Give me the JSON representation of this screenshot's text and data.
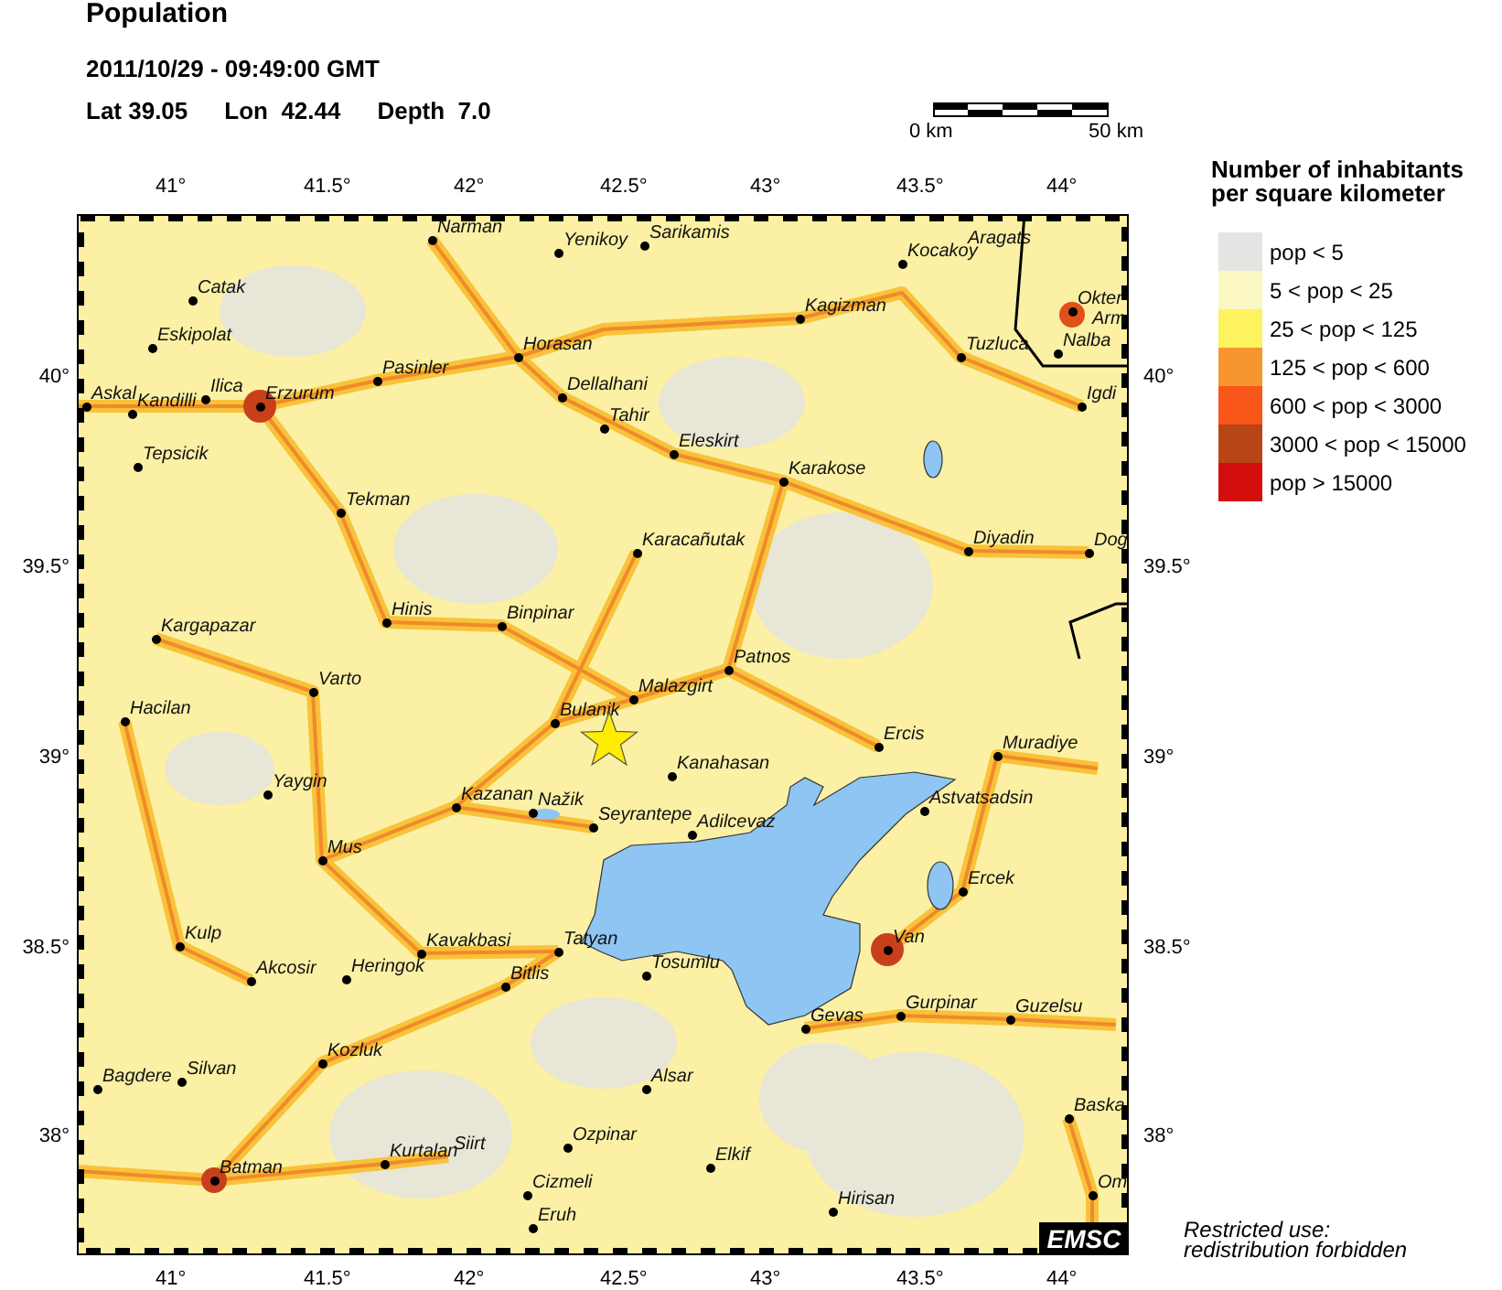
{
  "header": {
    "title": "Population",
    "datetime": "2011/10/29 - 09:49:00 GMT",
    "lat": "Lat 39.05",
    "lon": "Lon  42.44",
    "depth": "Depth  7.0"
  },
  "scale_bar": {
    "start": "0 km",
    "end": "50 km"
  },
  "map": {
    "top_axis": [
      "41°",
      "41.5°",
      "42°",
      "42.5°",
      "43°",
      "43.5°",
      "44°"
    ],
    "bottom_axis": [
      "41°",
      "41.5°",
      "42°",
      "42.5°",
      "43°",
      "43.5°",
      "44°"
    ],
    "left_axis": [
      "40°",
      "39.5°",
      "39°",
      "38.5°",
      "38°"
    ],
    "right_axis": [
      "40°",
      "39.5°",
      "39°",
      "38.5°",
      "38°"
    ],
    "badge": "EMSC",
    "cities": [
      {
        "name": "Narman",
        "kind": "town"
      },
      {
        "name": "Yenikoy",
        "kind": "town"
      },
      {
        "name": "Sarikamis",
        "kind": "town"
      },
      {
        "name": "Kocakoy",
        "kind": "town"
      },
      {
        "name": "Aragats",
        "kind": "label"
      },
      {
        "name": "Catak",
        "kind": "town"
      },
      {
        "name": "Kagizman",
        "kind": "town"
      },
      {
        "name": "Okter",
        "kind": "town"
      },
      {
        "name": "Arm",
        "kind": "label"
      },
      {
        "name": "Eskipolat",
        "kind": "town"
      },
      {
        "name": "Horasan",
        "kind": "town"
      },
      {
        "name": "Tuzluca",
        "kind": "town"
      },
      {
        "name": "Nalba",
        "kind": "town"
      },
      {
        "name": "Pasinler",
        "kind": "town"
      },
      {
        "name": "Askal",
        "kind": "town"
      },
      {
        "name": "Kandilli",
        "kind": "town"
      },
      {
        "name": "Ilica",
        "kind": "town"
      },
      {
        "name": "Erzurum",
        "kind": "town"
      },
      {
        "name": "Dellalhani",
        "kind": "town"
      },
      {
        "name": "Igdi",
        "kind": "town"
      },
      {
        "name": "Tahir",
        "kind": "town"
      },
      {
        "name": "Eleskirt",
        "kind": "town"
      },
      {
        "name": "Tepsicik",
        "kind": "town"
      },
      {
        "name": "Karakose",
        "kind": "town"
      },
      {
        "name": "Tekman",
        "kind": "town"
      },
      {
        "name": "Karacañutak",
        "kind": "town"
      },
      {
        "name": "Diyadin",
        "kind": "town"
      },
      {
        "name": "Dog",
        "kind": "town"
      },
      {
        "name": "Kargapazar",
        "kind": "town"
      },
      {
        "name": "Hinis",
        "kind": "town"
      },
      {
        "name": "Binpinar",
        "kind": "town"
      },
      {
        "name": "Patnos",
        "kind": "town"
      },
      {
        "name": "Varto",
        "kind": "town"
      },
      {
        "name": "Malazgirt",
        "kind": "town"
      },
      {
        "name": "Hacilan",
        "kind": "town"
      },
      {
        "name": "Bulanik",
        "kind": "town"
      },
      {
        "name": "Ercis",
        "kind": "town"
      },
      {
        "name": "Muradiye",
        "kind": "town"
      },
      {
        "name": "Kanahasan",
        "kind": "town"
      },
      {
        "name": "Yaygin",
        "kind": "town"
      },
      {
        "name": "Kazanan",
        "kind": "town"
      },
      {
        "name": "Nažik",
        "kind": "town"
      },
      {
        "name": "Seyrantepe",
        "kind": "town"
      },
      {
        "name": "Adilcevaz",
        "kind": "town"
      },
      {
        "name": "Astvatsadsin",
        "kind": "town"
      },
      {
        "name": "Mus",
        "kind": "town"
      },
      {
        "name": "Ercek",
        "kind": "town"
      },
      {
        "name": "Kulp",
        "kind": "town"
      },
      {
        "name": "Kavakbasi",
        "kind": "town"
      },
      {
        "name": "Tatyan",
        "kind": "town"
      },
      {
        "name": "Van",
        "kind": "town"
      },
      {
        "name": "Akcosir",
        "kind": "town"
      },
      {
        "name": "Heringok",
        "kind": "town"
      },
      {
        "name": "Bitlis",
        "kind": "town"
      },
      {
        "name": "Tosumlu",
        "kind": "town"
      },
      {
        "name": "Gevas",
        "kind": "town"
      },
      {
        "name": "Gurpinar",
        "kind": "town"
      },
      {
        "name": "Guzelsu",
        "kind": "town"
      },
      {
        "name": "Kozluk",
        "kind": "town"
      },
      {
        "name": "Bagdere",
        "kind": "town"
      },
      {
        "name": "Silvan",
        "kind": "town"
      },
      {
        "name": "Alsar",
        "kind": "town"
      },
      {
        "name": "Baska",
        "kind": "town"
      },
      {
        "name": "Kurtalan",
        "kind": "town"
      },
      {
        "name": "Siirt",
        "kind": "label"
      },
      {
        "name": "Ozpinar",
        "kind": "town"
      },
      {
        "name": "Elkif",
        "kind": "town"
      },
      {
        "name": "Batman",
        "kind": "town"
      },
      {
        "name": "Cizmeli",
        "kind": "town"
      },
      {
        "name": "Om",
        "kind": "town"
      },
      {
        "name": "Hirisan",
        "kind": "town"
      },
      {
        "name": "Eruh",
        "kind": "town"
      }
    ]
  },
  "legend": {
    "title": "Number of inhabitants\nper square kilometer",
    "items": [
      {
        "label": "pop < 5",
        "color": "#e4e4e2"
      },
      {
        "label": "5 < pop < 25",
        "color": "#fbf7c5"
      },
      {
        "label": "25 < pop < 125",
        "color": "#fdf35e"
      },
      {
        "label": "125 < pop < 600",
        "color": "#f7962e"
      },
      {
        "label": "600 < pop < 3000",
        "color": "#f9561a"
      },
      {
        "label": "3000 < pop < 15000",
        "color": "#b84516"
      },
      {
        "label": "pop > 15000",
        "color": "#d40d0d"
      }
    ]
  },
  "note": "Restricted use:\nredistribution forbidden"
}
